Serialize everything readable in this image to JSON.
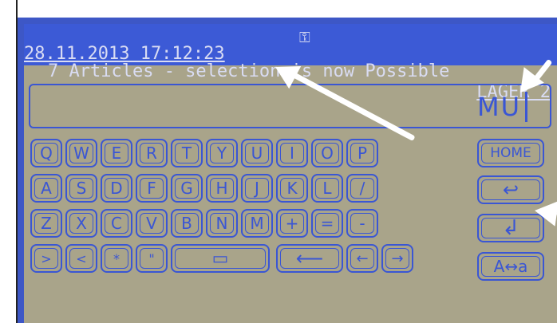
{
  "header": {
    "datetime": "28.11.2013 17:12:23",
    "location": "LAGER 2",
    "message": "7 Articles - selection is now Possible"
  },
  "input": {
    "value": "MU"
  },
  "keyboard": {
    "rows": [
      [
        "Q",
        "W",
        "E",
        "R",
        "T",
        "Y",
        "U",
        "I",
        "O",
        "P"
      ],
      [
        "A",
        "S",
        "D",
        "F",
        "G",
        "H",
        "J",
        "K",
        "L",
        "/"
      ],
      [
        "Z",
        "X",
        "C",
        "V",
        "B",
        "N",
        "M",
        "+",
        "=",
        "-"
      ],
      [
        ">",
        "<",
        "*",
        "\"",
        "space",
        "backspace",
        "left",
        "right"
      ]
    ],
    "side": {
      "home": "HOME",
      "back": "↩",
      "enter": "↲",
      "case": "A↔a"
    }
  },
  "symbols": {
    "space": "▭",
    "backspace": "⟵",
    "left": "←",
    "right": "→"
  },
  "icons": [
    "key-icon",
    "back-arrow-icon",
    "enter-icon",
    "annotation-arrow"
  ]
}
